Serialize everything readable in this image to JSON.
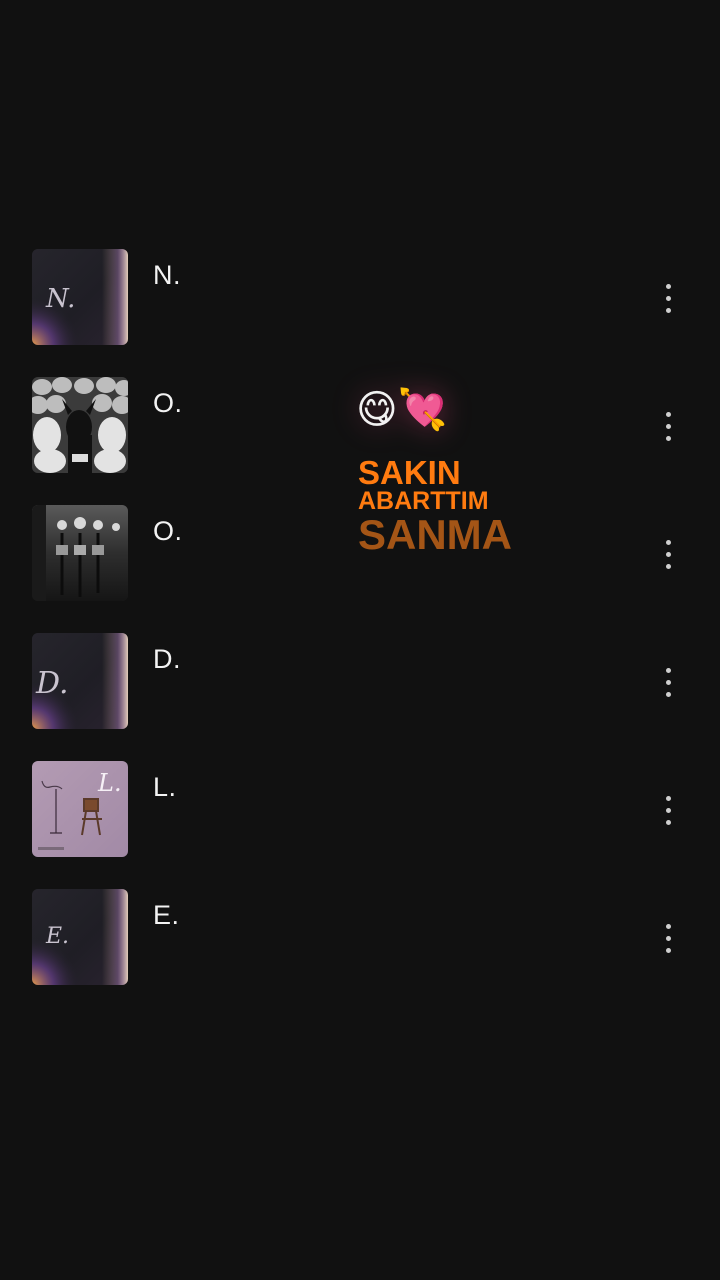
{
  "songs": [
    {
      "title": "N.",
      "art": "N.",
      "art_style": "dark-gradient"
    },
    {
      "title": "O.",
      "art": "",
      "art_style": "sheep-photo"
    },
    {
      "title": "O.",
      "art": "",
      "art_style": "bw-photo"
    },
    {
      "title": "D.",
      "art": "D.",
      "art_style": "dark-gradient"
    },
    {
      "title": "L.",
      "art": "L.",
      "art_style": "pink-chair"
    },
    {
      "title": "E.",
      "art": "E.",
      "art_style": "dark-gradient"
    }
  ],
  "sticker": {
    "emojis": "😋💘",
    "line1": "SAKIN",
    "line2": "ABARTTIM",
    "line3": "SANMA"
  },
  "icons": {
    "more": "more-vertical-icon"
  },
  "colors": {
    "background": "#111111",
    "sticker_orange": "#ff7b10",
    "sticker_brown": "#a45516"
  }
}
